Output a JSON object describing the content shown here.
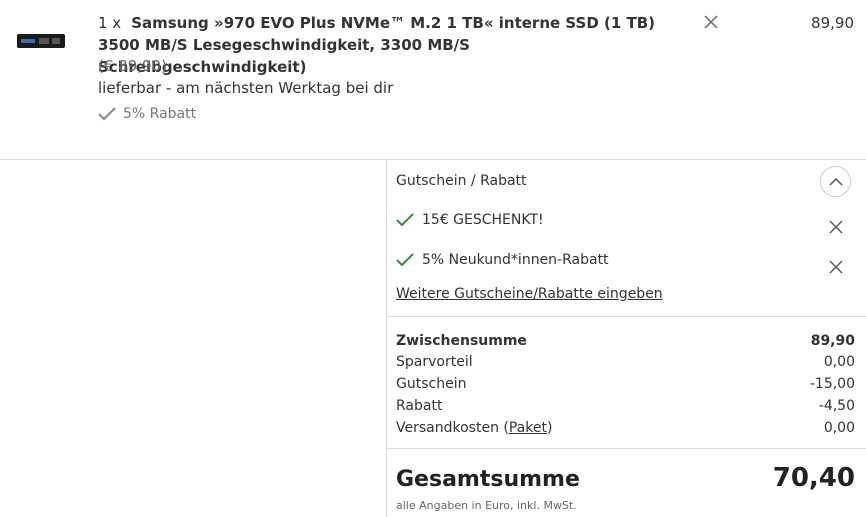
{
  "product": {
    "qty": "1 x",
    "name": "Samsung »970 EVO Plus NVMe™ M.2 1 TB« interne SSD (1 TB) 3500 MB/S Lesegeschwindigkeit, 3300 MB/S Schreibgeschwindigkeit)",
    "unit_price": "(€ 89,90)",
    "availability": "lieferbar - am nächsten Werktag bei dir",
    "discount": "5% Rabatt",
    "price": "89,90"
  },
  "vouchers": {
    "heading": "Gutschein / Rabatt",
    "items": [
      {
        "label": "15€ GESCHENKT!"
      },
      {
        "label": "5% Neukund*innen-Rabatt"
      }
    ],
    "more_link": "Weitere Gutscheine/Rabatte eingeben"
  },
  "summary": {
    "subtotal_label": "Zwischensumme",
    "subtotal_value": "89,90",
    "savings_label": "Sparvorteil",
    "savings_value": "0,00",
    "voucher_label": "Gutschein",
    "voucher_value": "-15,00",
    "discount_label": "Rabatt",
    "discount_value": "-4,50",
    "shipping_label": "Versandkosten",
    "shipping_link": "Paket",
    "shipping_value": "0,00",
    "total_label": "Gesamtsumme",
    "total_value": "70,40",
    "total_note": "alle Angaben in Euro, inkl. MwSt."
  },
  "colors": {
    "check_green": "#3a8a3a",
    "text": "#333333",
    "divider": "#dddddd"
  }
}
